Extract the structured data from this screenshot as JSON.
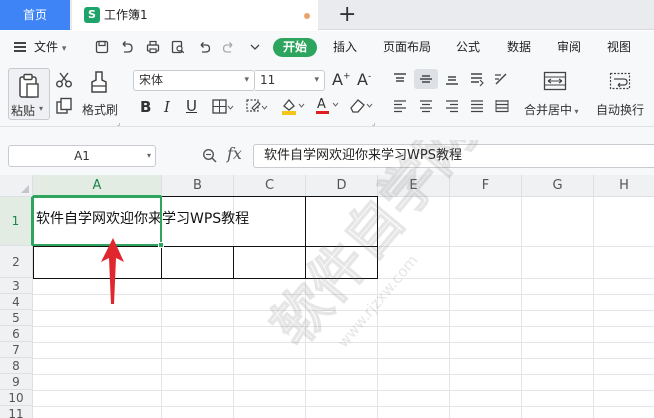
{
  "tabs": {
    "home": "首页",
    "document": "工作簿1",
    "doc_icon": "S"
  },
  "menu": {
    "file": "文件",
    "start": "开始",
    "items": [
      "插入",
      "页面布局",
      "公式",
      "数据",
      "审阅",
      "视图"
    ]
  },
  "ribbon": {
    "paste": "粘贴",
    "format_painter": "格式刷",
    "font_name": "宋体",
    "font_size": "11",
    "merge_center": "合并居中",
    "auto_wrap": "自动换行",
    "fill_color": "#f5c518",
    "font_color": "#e02020"
  },
  "formula_bar": {
    "name_box": "A1",
    "fx": "fx",
    "content": "软件自学网欢迎你来学习WPS教程"
  },
  "sheet": {
    "columns": [
      "A",
      "B",
      "C",
      "D",
      "E",
      "F",
      "G",
      "H"
    ],
    "rows": [
      "1",
      "2",
      "3",
      "4",
      "5",
      "6",
      "7",
      "8",
      "9",
      "10",
      "11"
    ],
    "active_column": "A",
    "active_row": "1",
    "cell_a1": "软件自学网欢迎你来学习WPS教程"
  },
  "colors": {
    "accent_green": "#2ea55e",
    "home_tab_blue": "#3f84f6",
    "arrow_red": "#e0262e"
  },
  "watermark": {
    "text": "软件自学网",
    "url": "www.rjzxw.com"
  }
}
